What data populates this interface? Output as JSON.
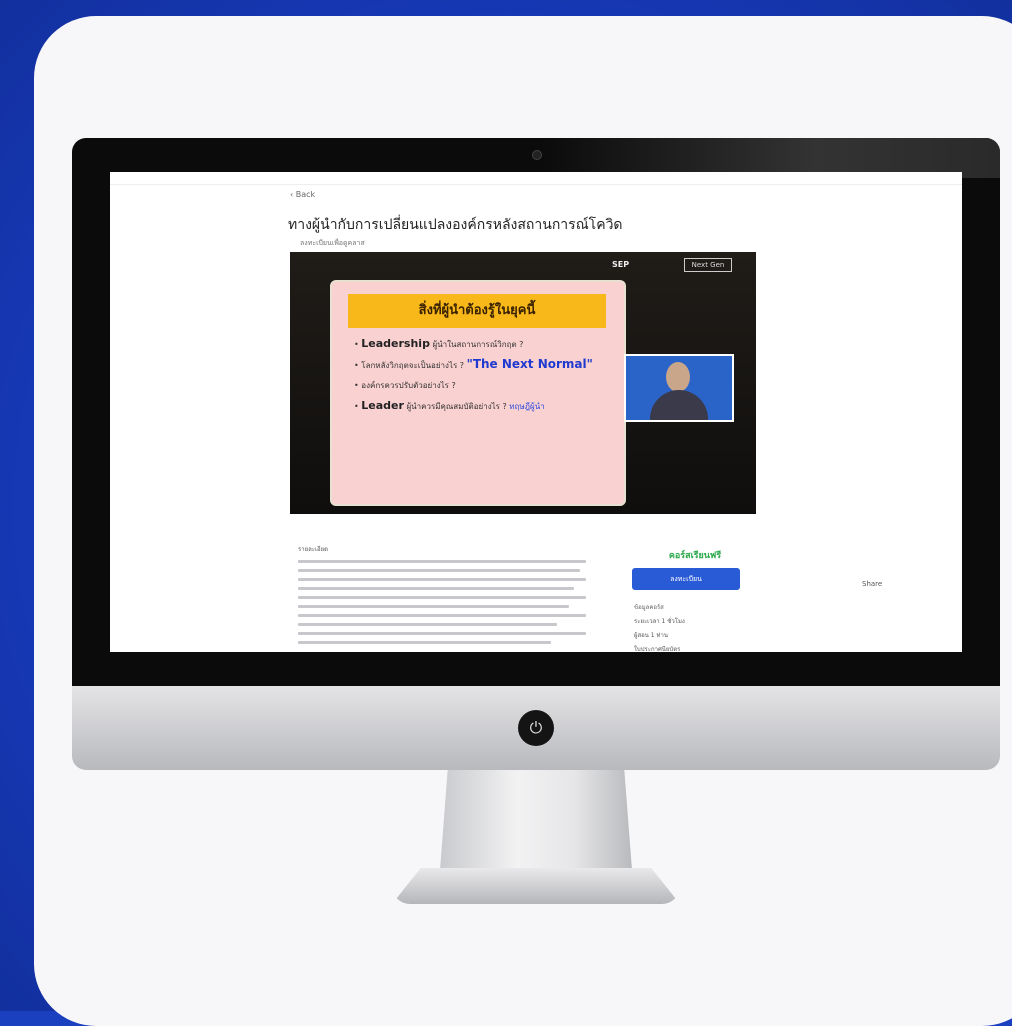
{
  "page": {
    "back_label": "‹ Back",
    "title": "ทางผู้นำกับการเปลี่ยนแปลงองค์กรหลังสถานการณ์โควิด",
    "subtitle": "ลงทะเบียนเพื่อดูคลาส"
  },
  "video": {
    "logo_text": "SEP",
    "logo_badge": "Next Gen",
    "slide_heading": "สิ่งที่ผู้นำต้องรู้ในยุคนี้",
    "bullets": [
      {
        "strong": "Leadership",
        "text": "ผู้นำในสถานการณ์วิกฤต ?",
        "blue": "",
        "link": ""
      },
      {
        "strong": "",
        "text": "โลกหลังวิกฤตจะเป็นอย่างไร ?",
        "blue": "\"The Next Normal\"",
        "link": ""
      },
      {
        "strong": "",
        "text": "องค์กรควรปรับตัวอย่างไร ?",
        "blue": "",
        "link": ""
      },
      {
        "strong": "Leader",
        "text": "ผู้นำควรมีคุณสมบัติอย่างไร ?",
        "blue": "",
        "link": "ทฤษฎีผู้นำ"
      }
    ]
  },
  "description": {
    "label": "รายละเอียด"
  },
  "sidebar": {
    "price": "คอร์สเรียนฟรี",
    "enroll_label": "ลงทะเบียน",
    "info_label": "ข้อมูลคอร์ส",
    "info_rows": [
      "ระยะเวลา 1 ชั่วโมง",
      "ผู้สอน 1 ท่าน",
      "ใบประกาศนียบัตร"
    ]
  },
  "share_label": "Share",
  "colors": {
    "background": "#1a3fbf",
    "enroll_button": "#2a5bd6",
    "slide_header": "#f9b81a",
    "slide_bg": "#fad1d1",
    "free_text": "#2aa84a"
  }
}
